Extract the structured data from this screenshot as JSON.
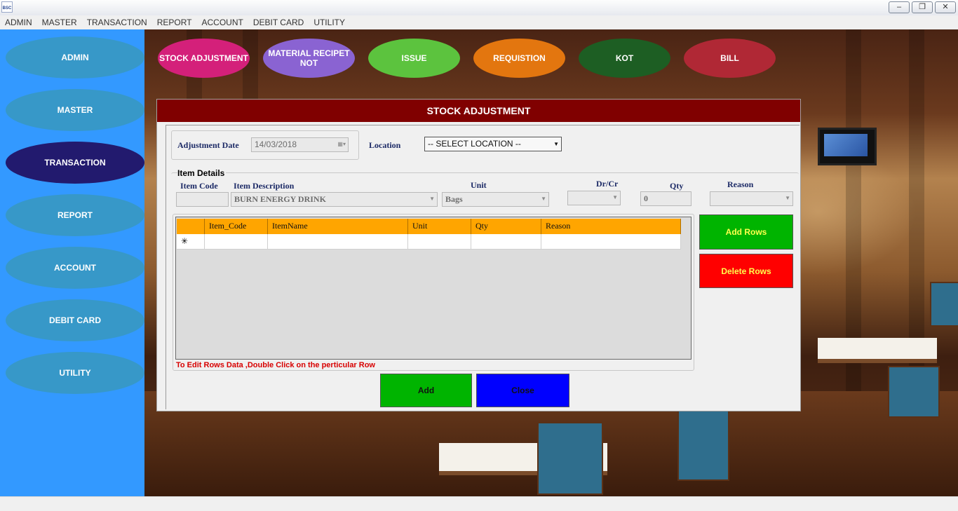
{
  "window": {
    "app_icon_text": "BSC",
    "controls": {
      "minimize": "–",
      "restore": "❐",
      "close": "✕"
    }
  },
  "menubar": {
    "items": [
      {
        "label": "ADMIN"
      },
      {
        "label": "MASTER"
      },
      {
        "label": "TRANSACTION"
      },
      {
        "label": "REPORT"
      },
      {
        "label": "ACCOUNT"
      },
      {
        "label": "DEBIT CARD"
      },
      {
        "label": "UTILITY"
      }
    ]
  },
  "sidenav": {
    "active": "TRANSACTION",
    "items": [
      {
        "label": "ADMIN"
      },
      {
        "label": "MASTER"
      },
      {
        "label": "TRANSACTION"
      },
      {
        "label": "REPORT"
      },
      {
        "label": "ACCOUNT"
      },
      {
        "label": "DEBIT CARD"
      },
      {
        "label": "UTILITY"
      }
    ]
  },
  "top_actions": [
    {
      "label": "STOCK ADJUSTMENT",
      "color": "#d4207a"
    },
    {
      "label": "MATERIAL RECIPET NOT",
      "color": "#8a63d2"
    },
    {
      "label": "ISSUE",
      "color": "#5cc33e"
    },
    {
      "label": "REQUISTION",
      "color": "#e3760f"
    },
    {
      "label": "KOT",
      "color": "#1d5e23"
    },
    {
      "label": "BILL",
      "color": "#b02835"
    }
  ],
  "form": {
    "title": "STOCK ADJUSTMENT",
    "adjustment_date": {
      "label": "Adjustment Date",
      "value": "14/03/2018"
    },
    "location": {
      "label": "Location",
      "value": "-- SELECT LOCATION --"
    },
    "item_details": {
      "heading": "Item Details",
      "item_code": {
        "label": "Item Code",
        "value": ""
      },
      "item_description": {
        "label": "Item Description",
        "value": "BURN ENERGY DRINK"
      },
      "unit": {
        "label": "Unit",
        "value": "Bags"
      },
      "drcr": {
        "label": "Dr/Cr",
        "value": ""
      },
      "qty": {
        "label": "Qty",
        "value": "0"
      },
      "reason": {
        "label": "Reason",
        "value": ""
      }
    },
    "grid": {
      "columns": [
        "Item_Code",
        "ItemName",
        "Unit",
        "Qty",
        "Reason"
      ],
      "new_row_marker": "✳",
      "hint": "To Edit Rows Data ,Double Click on the perticular Row"
    },
    "buttons": {
      "add_rows": "Add Rows",
      "delete_rows": "Delete Rows",
      "add": "Add",
      "close": "Close"
    }
  },
  "colors": {
    "sidenav_bg": "#3399ff",
    "nav_pill": "#3798c8",
    "nav_pill_active": "#221a6e",
    "form_header": "#800000",
    "grid_header": "#ffa500",
    "btn_green": "#00b400",
    "btn_red": "#ff0000",
    "btn_blue": "#0000ff"
  }
}
